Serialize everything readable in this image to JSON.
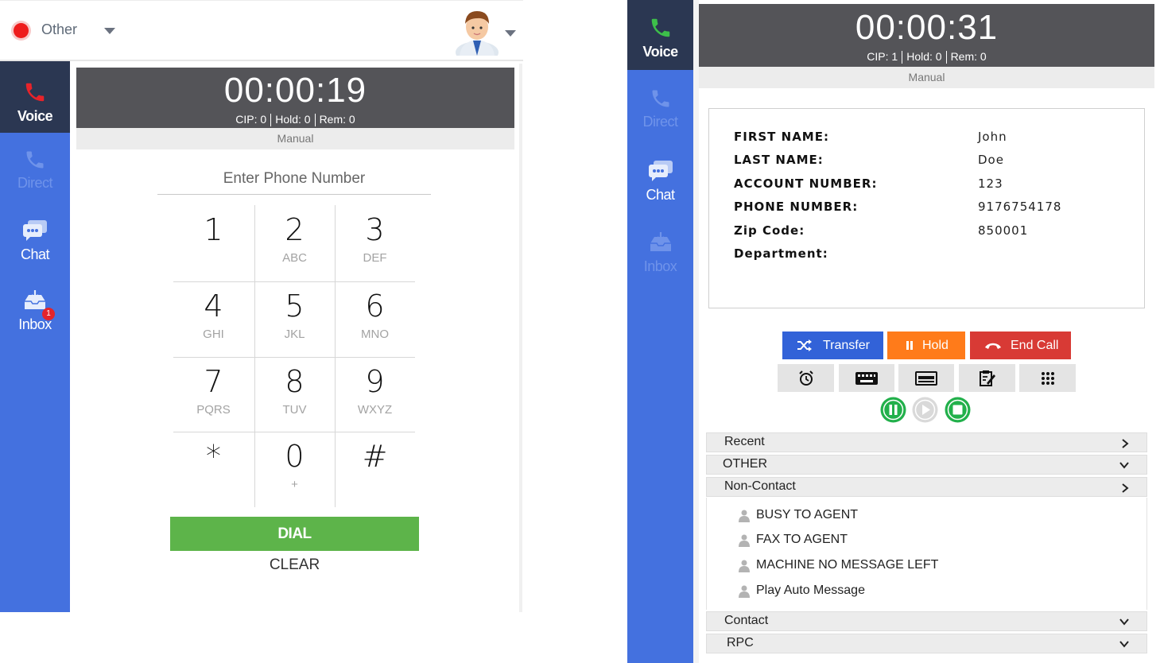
{
  "left": {
    "status": {
      "label": "Other",
      "color": "#ee1c1c"
    },
    "nav": [
      {
        "label": "Voice",
        "icon": "phone-icon",
        "state": "active"
      },
      {
        "label": "Direct",
        "icon": "phone-icon",
        "state": "disabled"
      },
      {
        "label": "Chat",
        "icon": "chat-icon",
        "state": "normal"
      },
      {
        "label": "Inbox",
        "icon": "inbox-icon",
        "state": "normal",
        "badge": "1"
      }
    ],
    "timer": "00:00:19",
    "counts": {
      "cip": "CIP: 0",
      "hold": "Hold: 0",
      "rem": "Rem: 0"
    },
    "mode": "Manual",
    "phone_placeholder": "Enter Phone Number",
    "keypad": [
      {
        "digit": "1",
        "letters": ""
      },
      {
        "digit": "2",
        "letters": "ABC"
      },
      {
        "digit": "3",
        "letters": "DEF"
      },
      {
        "digit": "4",
        "letters": "GHI"
      },
      {
        "digit": "5",
        "letters": "JKL"
      },
      {
        "digit": "6",
        "letters": "MNO"
      },
      {
        "digit": "7",
        "letters": "PQRS"
      },
      {
        "digit": "8",
        "letters": "TUV"
      },
      {
        "digit": "9",
        "letters": "WXYZ"
      },
      {
        "digit": "*",
        "letters": ""
      },
      {
        "digit": "0",
        "letters": "+"
      },
      {
        "digit": "#",
        "letters": ""
      }
    ],
    "dial_label": "DIAL",
    "clear_label": "CLEAR"
  },
  "right": {
    "nav": [
      {
        "label": "Voice",
        "icon": "phone-icon",
        "state": "active"
      },
      {
        "label": "Direct",
        "icon": "phone-icon",
        "state": "disabled"
      },
      {
        "label": "Chat",
        "icon": "chat-icon",
        "state": "normal"
      },
      {
        "label": "Inbox",
        "icon": "inbox-icon",
        "state": "disabled"
      }
    ],
    "timer": "00:00:31",
    "counts": {
      "cip": "CIP: 1",
      "hold": "Hold: 0",
      "rem": "Rem: 0"
    },
    "mode": "Manual",
    "contact_fields": [
      {
        "key": "FIRST NAME",
        "value": "John"
      },
      {
        "key": "LAST NAME",
        "value": "Doe"
      },
      {
        "key": "ACCOUNT NUMBER",
        "value": "123"
      },
      {
        "key": "PHONE NUMBER",
        "value": "9176754178"
      },
      {
        "key": "Zip Code",
        "value": "850001"
      },
      {
        "key": "Department",
        "value": ""
      }
    ],
    "actions": {
      "transfer": "Transfer",
      "hold": "Hold",
      "end_call": "End Call"
    },
    "colors": {
      "transfer": "#3262d8",
      "hold": "#ff7b1a",
      "end_call": "#d83a35",
      "record_green": "#22b04b",
      "sidebar": "#4471df",
      "sidebar_active": "#2b3752"
    },
    "tools": [
      "alarm-clock-icon",
      "keyboard-icon",
      "card-icon",
      "notes-icon",
      "keypad-grid-icon"
    ],
    "recording_controls": [
      "pause-icon",
      "play-icon",
      "stop-icon"
    ],
    "dispositions": [
      {
        "label": "Recent",
        "state": "collapsed"
      },
      {
        "label": "OTHER",
        "state": "expandable"
      },
      {
        "label": "Non-Contact",
        "state": "collapsed",
        "items": [
          "BUSY TO AGENT",
          "FAX TO AGENT",
          "MACHINE NO MESSAGE LEFT",
          "Play Auto Message"
        ]
      },
      {
        "label": "Contact",
        "state": "expandable"
      },
      {
        "label": "RPC",
        "state": "expandable"
      }
    ]
  }
}
